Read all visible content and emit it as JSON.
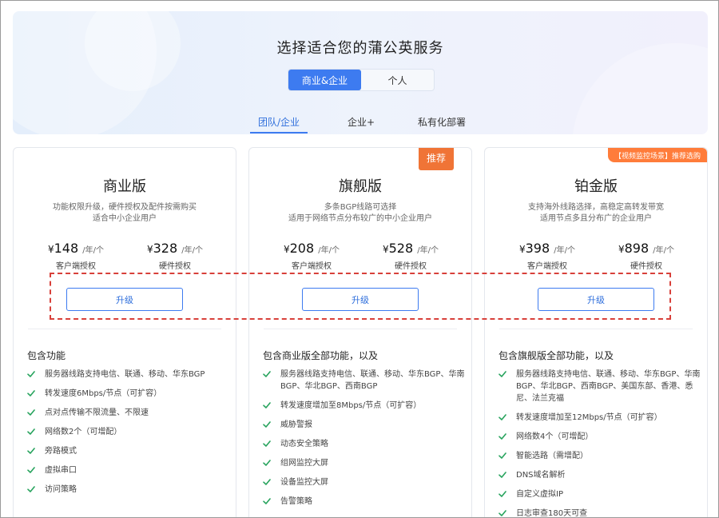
{
  "hero": {
    "title": "选择适合您的蒲公英服务",
    "segments": [
      "商业&企业",
      "个人"
    ],
    "tabs": [
      "团队/企业",
      "企业+",
      "私有化部署"
    ]
  },
  "colors": {
    "accent": "#3d7bf0",
    "check": "#27a35d",
    "badge": "#f07436",
    "highlight_dash": "#d8403a"
  },
  "plans": [
    {
      "name": "商业版",
      "desc1": "功能权限升级，硬件授权及配件按需购买",
      "desc2": "适合中小企业用户",
      "client_price": "148",
      "hw_price": "328",
      "currency": "¥",
      "unit": "/年/个",
      "client_label": "客户端授权",
      "hw_label": "硬件授权",
      "button": "升级",
      "features_title": "包含功能",
      "features": [
        "服务器线路支持电信、联通、移动、华东BGP",
        "转发速度6Mbps/节点（可扩容）",
        "点对点传输不限流量、不限速",
        "网络数2个（可增配）",
        "旁路模式",
        "虚拟串口",
        "访问策略"
      ]
    },
    {
      "name": "旗舰版",
      "badge": "推荐",
      "desc1": "多条BGP线路可选择",
      "desc2": "适用于网络节点分布较广的中小企业用户",
      "client_price": "208",
      "hw_price": "528",
      "currency": "¥",
      "unit": "/年/个",
      "client_label": "客户端授权",
      "hw_label": "硬件授权",
      "button": "升级",
      "features_title": "包含商业版全部功能，以及",
      "features": [
        "服务器线路支持电信、联通、移动、华东BGP、华南BGP、华北BGP、西南BGP",
        "转发速度增加至8Mbps/节点（可扩容）",
        "威胁警报",
        "动态安全策略",
        "组网监控大屏",
        "设备监控大屏",
        "告警策略"
      ]
    },
    {
      "name": "铂金版",
      "badge": "【视频监控场景】推荐选购",
      "desc1": "支持海外线路选择，高稳定高转发带宽",
      "desc2": "适用节点多且分布广的企业用户",
      "client_price": "398",
      "hw_price": "898",
      "currency": "¥",
      "unit": "/年/个",
      "client_label": "客户端授权",
      "hw_label": "硬件授权",
      "button": "升级",
      "features_title": "包含旗舰版全部功能，以及",
      "features": [
        "服务器线路支持电信、联通、移动、华东BGP、华南BGP、华北BGP、西南BGP、美国东部、香港、悉尼、法兰克福",
        "转发速度增加至12Mbps/节点（可扩容）",
        "网络数4个（可增配）",
        "智能选路（需增配）",
        "DNS域名解析",
        "自定义虚拟IP",
        "日志审查180天可查"
      ]
    }
  ]
}
